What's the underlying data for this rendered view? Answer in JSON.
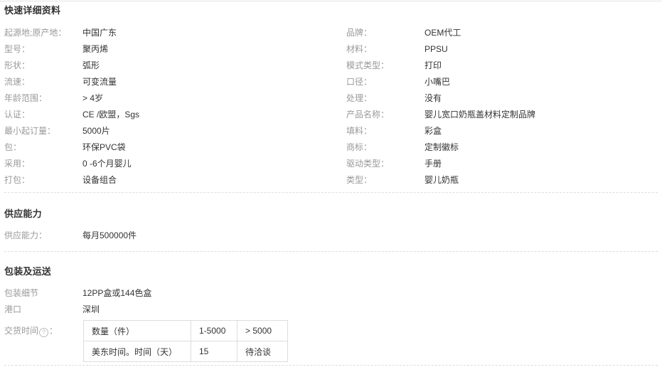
{
  "sections": {
    "quick_details": {
      "title": "快速详细资料",
      "left": [
        {
          "label": "起源地;原产地：",
          "value": "中国广东"
        },
        {
          "label": "型号：",
          "value": "聚丙烯"
        },
        {
          "label": "形状：",
          "value": "弧形"
        },
        {
          "label": "流速：",
          "value": "可变流量"
        },
        {
          "label": "年龄范围：",
          "value": "> 4岁"
        },
        {
          "label": "认证：",
          "value": "CE /欧盟，Sgs"
        },
        {
          "label": "最小起订量：",
          "value": "5000片"
        },
        {
          "label": "包：",
          "value": "环保PVC袋"
        },
        {
          "label": "采用：",
          "value": "0 -6个月婴儿"
        },
        {
          "label": "打包：",
          "value": "设备组合"
        }
      ],
      "right": [
        {
          "label": "品牌：",
          "value": "OEM代工"
        },
        {
          "label": "材料：",
          "value": "PPSU"
        },
        {
          "label": "模式类型：",
          "value": "打印"
        },
        {
          "label": "口径：",
          "value": "小嘴巴"
        },
        {
          "label": "处理：",
          "value": "没有"
        },
        {
          "label": "产品名称：",
          "value": "婴儿宽口奶瓶盖材料定制品牌"
        },
        {
          "label": "填料：",
          "value": "彩盒"
        },
        {
          "label": "商标：",
          "value": "定制徽标"
        },
        {
          "label": "驱动类型：",
          "value": "手册"
        },
        {
          "label": "类型：",
          "value": "婴儿奶瓶"
        }
      ]
    },
    "supply_ability": {
      "title": "供应能力",
      "rows": [
        {
          "label": "供应能力：",
          "value": "每月500000件"
        }
      ]
    },
    "packaging_delivery": {
      "title": "包装及运送",
      "rows": [
        {
          "label": "包装细节",
          "value": "12PP盒或144色盒"
        },
        {
          "label": "港口",
          "value": "深圳"
        }
      ],
      "lead_time": {
        "label_prefix": "交货时间",
        "label_suffix": "：",
        "help_icon": "?",
        "table": [
          [
            "数量（件）",
            "1-5000",
            "> 5000"
          ],
          [
            "美东时间。时间（天）",
            "15",
            "待洽谈"
          ]
        ]
      }
    }
  },
  "colors": {
    "label": "#999999",
    "value": "#333333",
    "divider": "#dcdcdc",
    "table_border": "#dddddd"
  }
}
